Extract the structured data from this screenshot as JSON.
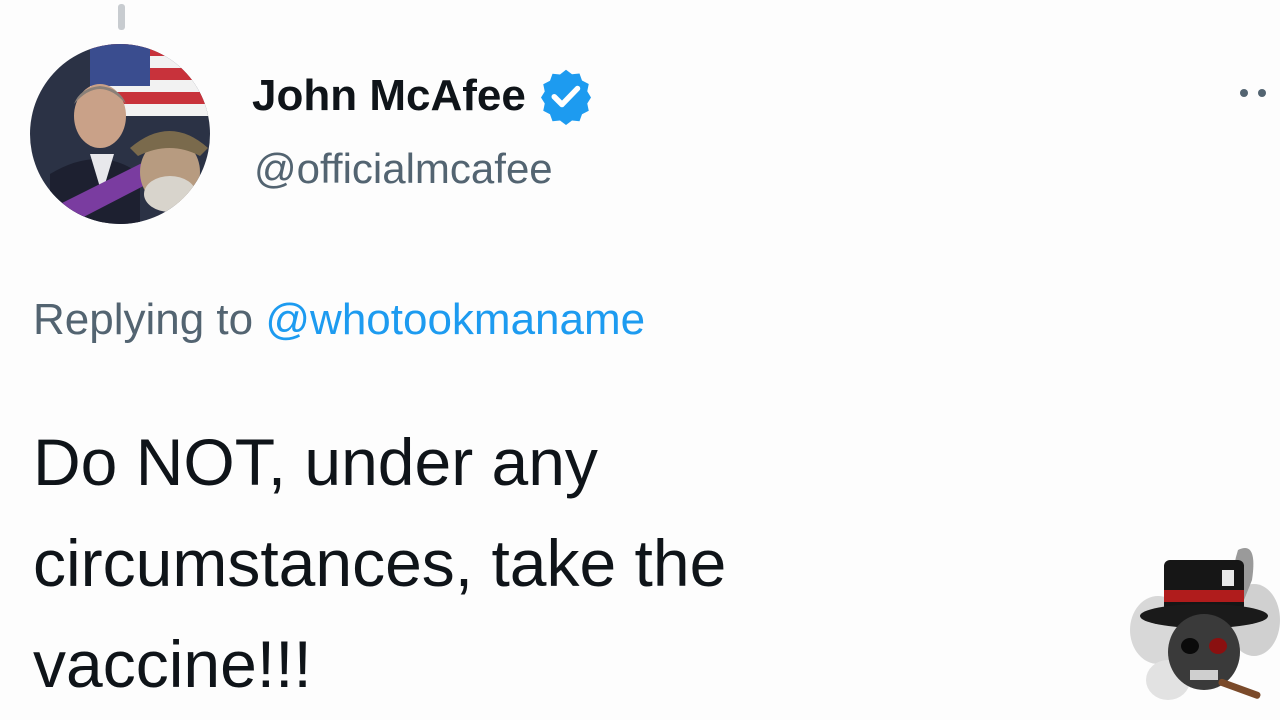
{
  "tweet": {
    "author": {
      "display_name": "John McAfee",
      "handle": "@officialmcafee",
      "verified": true,
      "verified_icon": "verified-badge-icon",
      "verified_color": "#1d9bf0"
    },
    "reply": {
      "prefix": "Replying to",
      "mention": "@whotookmaname"
    },
    "body_lines": [
      "Do NOT, under any",
      "circumstances, take the",
      "vaccine!!!"
    ],
    "more_icon": "more-options-icon"
  },
  "colors": {
    "text_primary": "#0f1419",
    "text_secondary": "#536471",
    "accent": "#1d9bf0"
  }
}
